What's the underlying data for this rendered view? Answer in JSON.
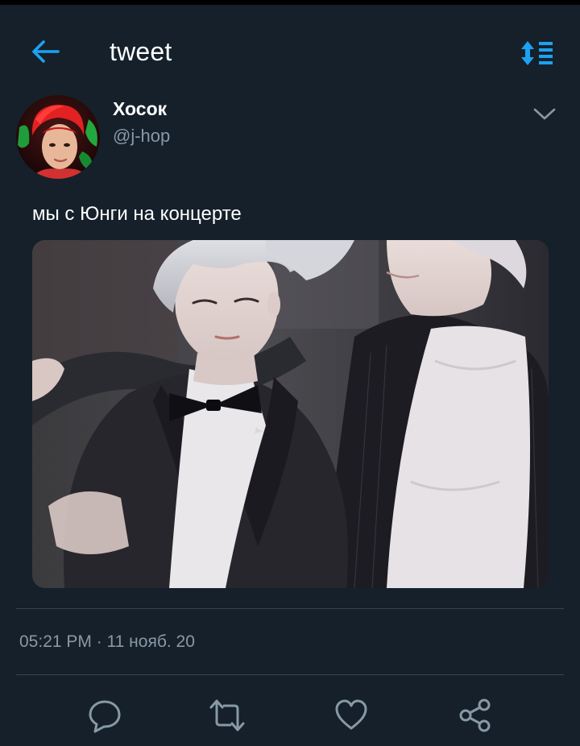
{
  "header": {
    "title": "tweet",
    "back_icon": "arrow-left-icon",
    "sort_icon": "sort-list-icon",
    "accent_color": "#1da1f2"
  },
  "author": {
    "name": "Хосок",
    "handle": "@j-hop",
    "avatar_icon": "avatar-photo",
    "menu_icon": "chevron-down-icon"
  },
  "tweet": {
    "text": "мы с Юнги на концерте",
    "media_icon": "photo",
    "timestamp": "05:21 PM · 11 нояб. 20"
  },
  "actions": [
    {
      "icon": "reply-icon"
    },
    {
      "icon": "retweet-icon"
    },
    {
      "icon": "like-icon"
    },
    {
      "icon": "share-icon"
    }
  ],
  "colors": {
    "background": "#15202b",
    "secondary_text": "#8899a6",
    "divider": "#38444d"
  }
}
